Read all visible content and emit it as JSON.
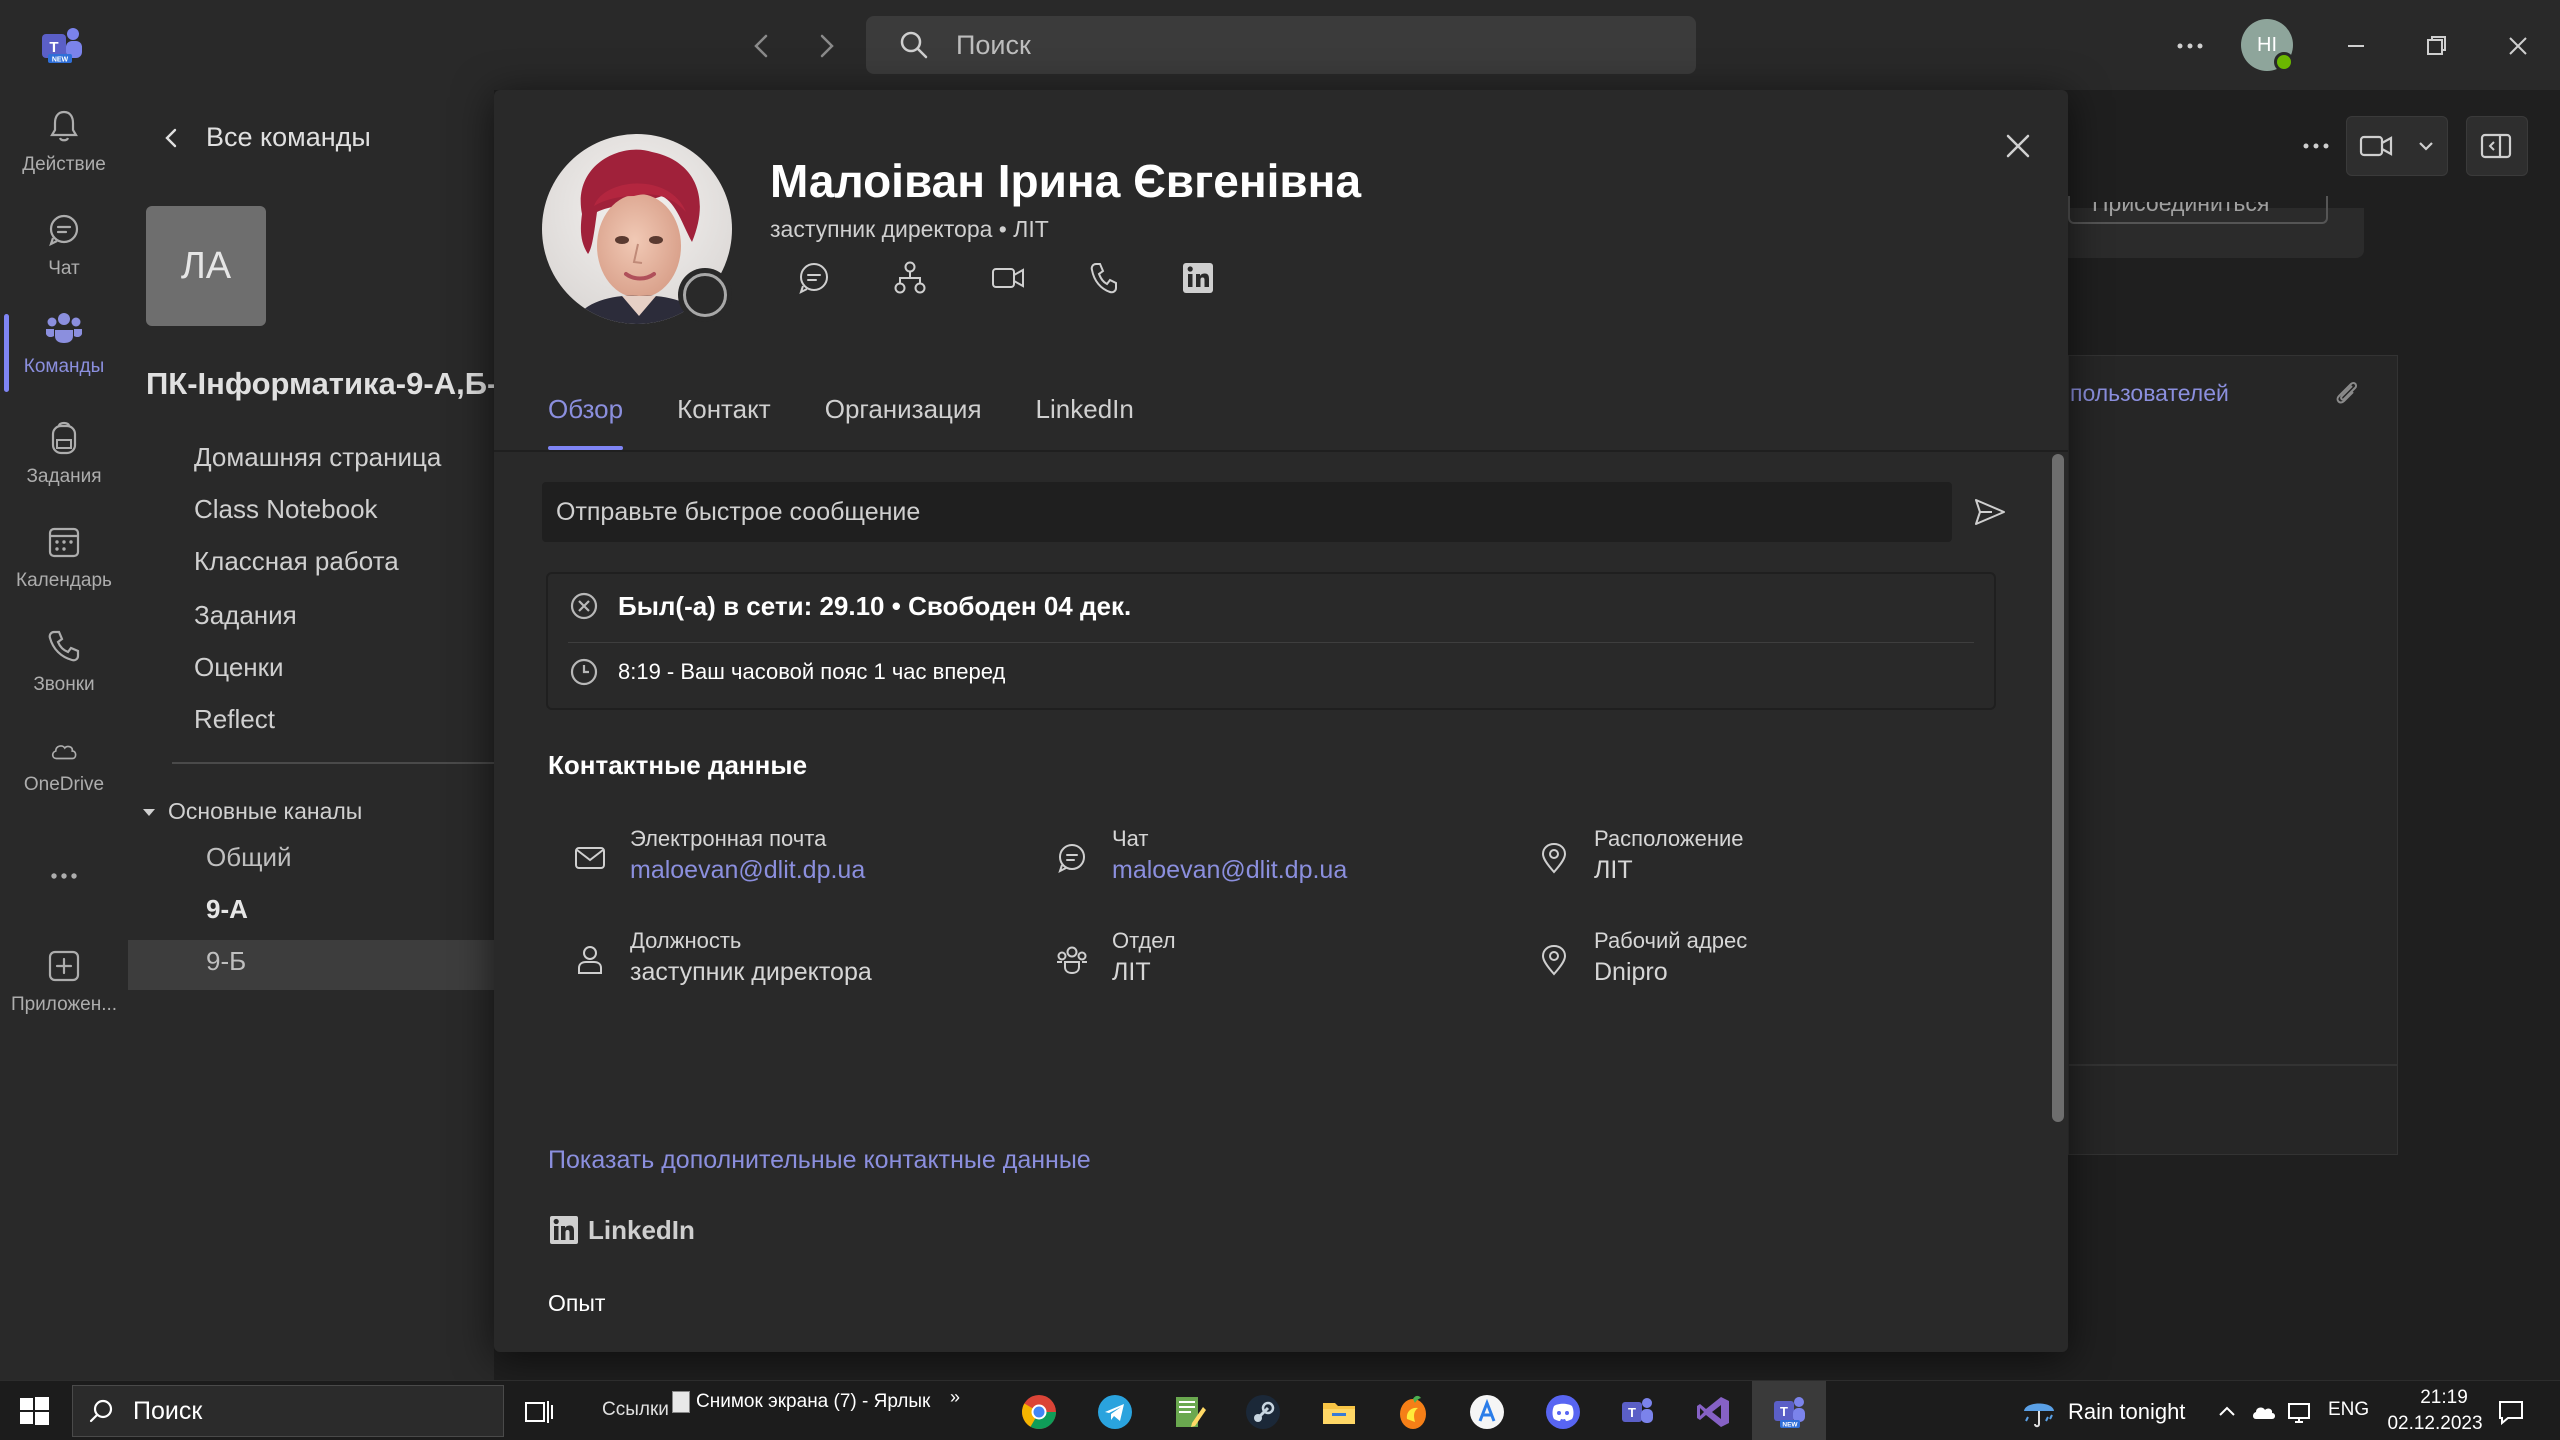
{
  "titlebar": {
    "search_placeholder": "Поиск",
    "user_initials": "HI"
  },
  "rail": {
    "items": [
      {
        "label": "Действие",
        "icon": "bell-icon"
      },
      {
        "label": "Чат",
        "icon": "chat-icon"
      },
      {
        "label": "Команды",
        "icon": "teams-icon",
        "active": true
      },
      {
        "label": "Задания",
        "icon": "backpack-icon"
      },
      {
        "label": "Календарь",
        "icon": "calendar-icon"
      },
      {
        "label": "Звонки",
        "icon": "phone-icon"
      },
      {
        "label": "OneDrive",
        "icon": "cloud-icon"
      },
      {
        "label": "",
        "icon": "more-icon"
      },
      {
        "label": "Приложен...",
        "icon": "add-apps-icon"
      }
    ]
  },
  "team_panel": {
    "back_label": "Все команды",
    "avatar_initials": "ЛА",
    "team_name": "ПК-Інформатика-9-А,Б-",
    "links": [
      "Домашняя страница",
      "Class Notebook",
      "Классная работа",
      "Задания",
      "Оценки",
      "Reflect"
    ],
    "channels_header": "Основные каналы",
    "channels": [
      "Общий",
      "9-А",
      "9-Б"
    ]
  },
  "background": {
    "join_label": "Присоединиться",
    "users_link": "пользователей"
  },
  "profile": {
    "name": "Малоіван Ірина Євгенівна",
    "subtitle": "заступник директора • ЛІТ",
    "tabs": [
      "Обзор",
      "Контакт",
      "Организация",
      "LinkedIn"
    ],
    "quick_message_placeholder": "Отправьте быстрое сообщение",
    "status_line": "Был(-а) в сети: 29.10 • Свободен 04 дек.",
    "timezone_line": "8:19 - Ваш часовой пояс 1 час вперед",
    "contact_heading": "Контактные данные",
    "contact_fields": [
      {
        "label": "Электронная почта",
        "value": "maloevan@dlit.dp.ua",
        "link": true,
        "icon": "mail-icon"
      },
      {
        "label": "Чат",
        "value": "maloevan@dlit.dp.ua",
        "link": true,
        "icon": "chat-icon"
      },
      {
        "label": "Расположение",
        "value": "ЛІТ",
        "link": false,
        "icon": "location-icon"
      },
      {
        "label": "Должность",
        "value": "заступник директора",
        "link": false,
        "icon": "person-icon"
      },
      {
        "label": "Отдел",
        "value": "ЛІТ",
        "link": false,
        "icon": "group-icon"
      },
      {
        "label": "Рабочий адрес",
        "value": "Dnipro",
        "link": false,
        "icon": "location-icon"
      }
    ],
    "more_contacts_link": "Показать дополнительные контактные данные",
    "linkedin_heading": "LinkedIn",
    "experience_label": "Опыт"
  },
  "taskbar": {
    "search_label": "Поиск",
    "links_label": "Ссылки",
    "shortcut_label": "Снимок экрана (7) - Ярлык",
    "weather": "Rain tonight",
    "language": "ENG",
    "time": "21:19",
    "date": "02.12.2023",
    "apps": [
      "chrome",
      "telegram",
      "notepad",
      "steam",
      "file-explorer",
      "fl-studio",
      "app-store",
      "discord",
      "teams-classic",
      "visual-studio",
      "teams-new"
    ]
  },
  "colors": {
    "accent": "#7f85f5",
    "link": "#8b8fde",
    "modal_bg": "#292929",
    "app_bg": "#1f1f1f"
  }
}
